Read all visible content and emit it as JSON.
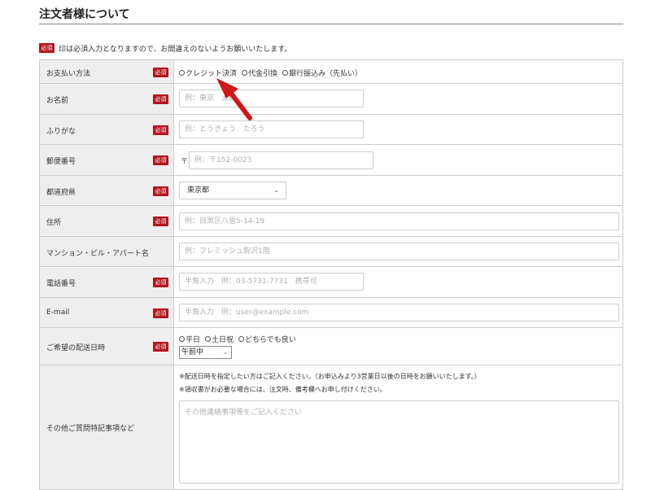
{
  "header": {
    "title": "注文者様について"
  },
  "note": {
    "badge": "必須",
    "text": "印は必須入力となりますので、お間違えのないようお願いいたします。"
  },
  "required_badge": "必須",
  "rows": {
    "payment": {
      "label": "お支払い方法",
      "options": [
        "クレジット決済",
        "代金引換",
        "銀行振込み（先払い）"
      ]
    },
    "name": {
      "label": "お名前",
      "placeholder": "例：東京　太郎"
    },
    "kana": {
      "label": "ふりがな",
      "placeholder": "例：とうきょう　たろう"
    },
    "postal": {
      "label": "郵便番号",
      "mark": "〒",
      "placeholder": "例：〒152-0023"
    },
    "prefecture": {
      "label": "都道府県",
      "value": "東京都"
    },
    "address": {
      "label": "住所",
      "placeholder": "例：目黒区八雲5-14-19"
    },
    "building": {
      "label": "マンション・ビル・アパート名",
      "placeholder": "例：フレミッシュ駒沢1階"
    },
    "phone": {
      "label": "電話番号",
      "placeholder": "半角入力　例：03-5731-7731　携帯可"
    },
    "email": {
      "label": "E-mail",
      "placeholder": "半角入力　例：user@example.com"
    },
    "delivery_date": {
      "label": "ご希望の配送日時",
      "options": [
        "平日",
        "土日祝",
        "どちらでも良い"
      ],
      "time_value": "午前中"
    },
    "notes": {
      "label": "その他ご質問特記事項など",
      "line1": "※配送日時を指定したい方はご記入ください。（お申込みより3営業日以後の日時をお願いいたします。）",
      "line2": "※領収書がお必要な場合には、注文時、備考欄へお申し付けください。",
      "placeholder": "その他連絡事項等をご記入ください"
    }
  },
  "colors": {
    "badge": "#b4141c",
    "label_bg": "#eeeeee",
    "arrow": "#cc1818"
  }
}
